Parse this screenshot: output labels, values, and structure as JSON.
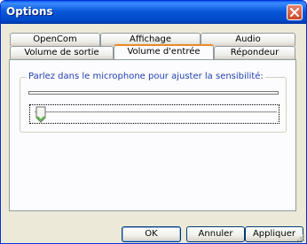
{
  "window": {
    "title": "Options"
  },
  "tabs": {
    "row_back": [
      {
        "label": "OpenCom"
      },
      {
        "label": "Affichage"
      },
      {
        "label": "Audio"
      }
    ],
    "row_front": [
      {
        "label": "Volume de sortie"
      },
      {
        "label": "Volume d'entrée"
      },
      {
        "label": "Répondeur"
      }
    ],
    "selected": "Volume d'entrée"
  },
  "panel": {
    "group_label": "Parlez dans le microphone pour ajuster la sensibilité:",
    "input_level": 0,
    "sensitivity_slider": 0
  },
  "buttons": {
    "ok": "OK",
    "cancel": "Annuler",
    "apply": "Appliquer"
  },
  "colors": {
    "titlebar": "#0a5de8",
    "active_tab_accent": "#e68b2c",
    "group_label": "#1f3eb0",
    "close": "#c9472a"
  },
  "icons": {
    "close": "close-icon",
    "thumb": "slider-thumb",
    "grip": "size-grip-icon"
  }
}
